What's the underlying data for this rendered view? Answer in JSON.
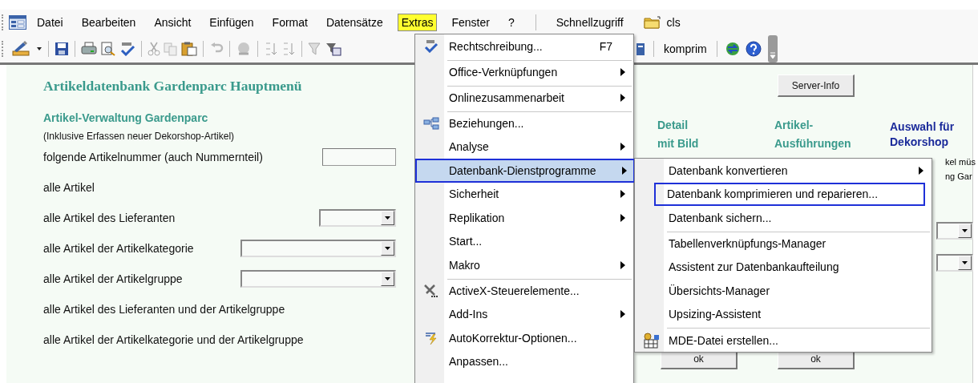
{
  "menubar": [
    {
      "label": "Datei",
      "selected": false
    },
    {
      "label": "Bearbeiten",
      "selected": false
    },
    {
      "label": "Ansicht",
      "selected": false
    },
    {
      "label": "Einfügen",
      "selected": false
    },
    {
      "label": "Format",
      "selected": false
    },
    {
      "label": "Datensätze",
      "selected": false
    },
    {
      "label": "Extras",
      "selected": true
    },
    {
      "label": "Fenster",
      "selected": false
    },
    {
      "label": "?",
      "selected": false
    }
  ],
  "quick_access": {
    "label": "Schnellzugriff"
  },
  "folder": {
    "label": "cls"
  },
  "toolbar": {
    "compress_button": {
      "label": "komprim"
    }
  },
  "form": {
    "title": "Artikeldatenbank Gardenparc Hauptmenü",
    "section_title": "Artikel-Verwaltung Gardenparc",
    "section_note": "(Inklusive Erfassen neuer Dekorshop-Artikel)",
    "rows": [
      {
        "label": "folgende Artikelnummer (auch Nummernteil)",
        "kind": "input"
      },
      {
        "label": "alle Artikel",
        "kind": "none"
      },
      {
        "label": "alle Artikel des Lieferanten",
        "kind": "combo-short"
      },
      {
        "label": "alle Artikel der Artikelkategorie",
        "kind": "combo-long"
      },
      {
        "label": "alle Artikel der Artikelgruppe",
        "kind": "combo-long"
      },
      {
        "label": "alle Artikel des Lieferanten und der Artikelgruppe",
        "kind": "none"
      },
      {
        "label": "alle Artikel der Artikelkategorie und der Artikelgruppe",
        "kind": "none"
      }
    ],
    "server_button": "Server-Info",
    "columns": [
      {
        "lines": [
          "Detail",
          "mit Bild"
        ],
        "kind": "teal"
      },
      {
        "lines": [
          "Artikel-",
          "Ausführungen"
        ],
        "kind": "teal"
      },
      {
        "lines": [
          "Auswahl für",
          "Dekorshop"
        ],
        "kind": "navy"
      }
    ],
    "note_fragments": [
      "kel müs",
      "ng Gar"
    ],
    "ok_buttons": [
      "ok",
      "ok"
    ]
  },
  "extras_menu": [
    {
      "label": "Rechtschreibung...",
      "shortcut": "F7",
      "submenu": false,
      "separator_before": false,
      "selected": false
    },
    {
      "label": "Office-Verknüpfungen",
      "submenu": true,
      "separator_before": true,
      "selected": false
    },
    {
      "label": "Onlinezusammenarbeit",
      "submenu": true,
      "separator_before": true,
      "selected": false
    },
    {
      "label": "Beziehungen...",
      "submenu": false,
      "separator_before": true,
      "selected": false
    },
    {
      "label": "Analyse",
      "submenu": true,
      "separator_before": false,
      "selected": false
    },
    {
      "label": "Datenbank-Dienstprogramme",
      "submenu": true,
      "separator_before": false,
      "selected": true
    },
    {
      "label": "Sicherheit",
      "submenu": true,
      "separator_before": false,
      "selected": false
    },
    {
      "label": "Replikation",
      "submenu": true,
      "separator_before": false,
      "selected": false
    },
    {
      "label": "Start...",
      "submenu": false,
      "separator_before": false,
      "selected": false
    },
    {
      "label": "Makro",
      "submenu": true,
      "separator_before": false,
      "selected": false
    },
    {
      "label": "ActiveX-Steuerelemente...",
      "submenu": false,
      "separator_before": true,
      "selected": false
    },
    {
      "label": "Add-Ins",
      "submenu": true,
      "separator_before": false,
      "selected": false
    },
    {
      "label": "AutoKorrektur-Optionen...",
      "submenu": false,
      "separator_before": false,
      "selected": false
    },
    {
      "label": "Anpassen...",
      "submenu": false,
      "separator_before": false,
      "selected": false
    }
  ],
  "utilities_submenu": [
    {
      "label": "Datenbank konvertieren",
      "submenu": true,
      "separator_before": false,
      "selected": false
    },
    {
      "label": "Datenbank komprimieren und reparieren...",
      "submenu": false,
      "separator_before": false,
      "selected": true
    },
    {
      "label": "Datenbank sichern...",
      "submenu": false,
      "separator_before": false,
      "selected": false
    },
    {
      "label": "Tabellenverknüpfungs-Manager",
      "submenu": false,
      "separator_before": true,
      "selected": false
    },
    {
      "label": "Assistent zur Datenbankaufteilung",
      "submenu": false,
      "separator_before": false,
      "selected": false
    },
    {
      "label": "Übersichts-Manager",
      "submenu": false,
      "separator_before": false,
      "selected": false
    },
    {
      "label": "Upsizing-Assistent",
      "submenu": false,
      "separator_before": false,
      "selected": false
    },
    {
      "label": "MDE-Datei erstellen...",
      "submenu": false,
      "separator_before": true,
      "selected": false
    }
  ]
}
